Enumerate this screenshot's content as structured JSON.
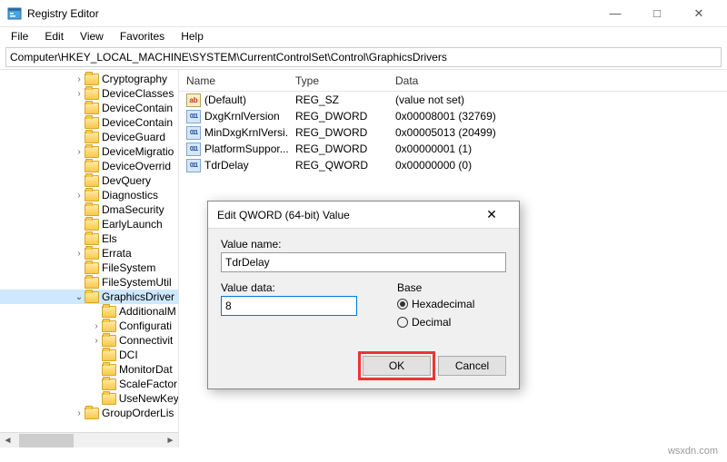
{
  "titlebar": {
    "title": "Registry Editor"
  },
  "menu": [
    "File",
    "Edit",
    "View",
    "Favorites",
    "Help"
  ],
  "address": "Computer\\HKEY_LOCAL_MACHINE\\SYSTEM\\CurrentControlSet\\Control\\GraphicsDrivers",
  "list": {
    "columns": [
      "Name",
      "Type",
      "Data"
    ],
    "rows": [
      {
        "icon": "sz",
        "name": "(Default)",
        "type": "REG_SZ",
        "data": "(value not set)"
      },
      {
        "icon": "bin",
        "name": "DxgKrnlVersion",
        "type": "REG_DWORD",
        "data": "0x00008001 (32769)"
      },
      {
        "icon": "bin",
        "name": "MinDxgKrnlVersi...",
        "type": "REG_DWORD",
        "data": "0x00005013 (20499)"
      },
      {
        "icon": "bin",
        "name": "PlatformSuppor...",
        "type": "REG_DWORD",
        "data": "0x00000001 (1)"
      },
      {
        "icon": "bin",
        "name": "TdrDelay",
        "type": "REG_QWORD",
        "data": "0x00000000 (0)"
      }
    ]
  },
  "tree": [
    {
      "indent": 81,
      "exp": ">",
      "label": "Cryptography"
    },
    {
      "indent": 81,
      "exp": ">",
      "label": "DeviceClasses"
    },
    {
      "indent": 81,
      "exp": "",
      "label": "DeviceContain"
    },
    {
      "indent": 81,
      "exp": "",
      "label": "DeviceContain"
    },
    {
      "indent": 81,
      "exp": "",
      "label": "DeviceGuard"
    },
    {
      "indent": 81,
      "exp": ">",
      "label": "DeviceMigratio"
    },
    {
      "indent": 81,
      "exp": "",
      "label": "DeviceOverrid"
    },
    {
      "indent": 81,
      "exp": "",
      "label": "DevQuery"
    },
    {
      "indent": 81,
      "exp": ">",
      "label": "Diagnostics"
    },
    {
      "indent": 81,
      "exp": "",
      "label": "DmaSecurity"
    },
    {
      "indent": 81,
      "exp": "",
      "label": "EarlyLaunch"
    },
    {
      "indent": 81,
      "exp": "",
      "label": "Els"
    },
    {
      "indent": 81,
      "exp": ">",
      "label": "Errata"
    },
    {
      "indent": 81,
      "exp": "",
      "label": "FileSystem"
    },
    {
      "indent": 81,
      "exp": "",
      "label": "FileSystemUtil"
    },
    {
      "indent": 81,
      "exp": "v",
      "label": "GraphicsDriver",
      "selected": true
    },
    {
      "indent": 100,
      "exp": "",
      "label": "AdditionalM"
    },
    {
      "indent": 100,
      "exp": ">",
      "label": "Configurati"
    },
    {
      "indent": 100,
      "exp": ">",
      "label": "Connectivit"
    },
    {
      "indent": 100,
      "exp": "",
      "label": "DCI"
    },
    {
      "indent": 100,
      "exp": "",
      "label": "MonitorDat"
    },
    {
      "indent": 100,
      "exp": "",
      "label": "ScaleFactor"
    },
    {
      "indent": 100,
      "exp": "",
      "label": "UseNewKey"
    },
    {
      "indent": 81,
      "exp": ">",
      "label": "GroupOrderLis"
    }
  ],
  "dialog": {
    "title": "Edit QWORD (64-bit) Value",
    "name_label": "Value name:",
    "name_value": "TdrDelay",
    "data_label": "Value data:",
    "data_value": "8",
    "base_label": "Base",
    "hex_label": "Hexadecimal",
    "dec_label": "Decimal",
    "ok": "OK",
    "cancel": "Cancel"
  },
  "watermark": "wsxdn.com"
}
